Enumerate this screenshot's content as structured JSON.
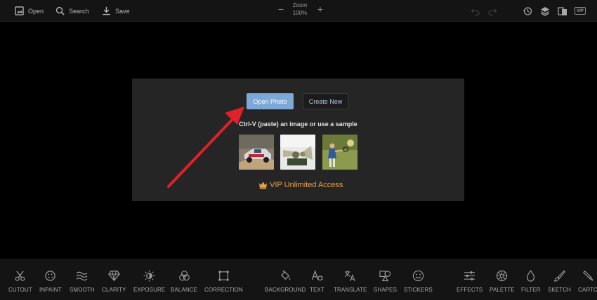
{
  "toolbar": {
    "open_label": "Open",
    "search_label": "Search",
    "save_label": "Save",
    "zoom_label": "Zoom",
    "zoom_value": "100%",
    "vip_tag": "VIP"
  },
  "dialog": {
    "open_photo": "Open Photo",
    "create_new": "Create New",
    "hint": "Ctrl-V (paste) an image or use a sample",
    "vip_link": "VIP Unlimited Access"
  },
  "tools": [
    {
      "label": "CUTOUT",
      "icon": "scissors-icon"
    },
    {
      "label": "INPAINT",
      "icon": "bandage-icon"
    },
    {
      "label": "SMOOTH",
      "icon": "waves-icon"
    },
    {
      "label": "CLARITY",
      "icon": "diamond-icon"
    },
    {
      "label": "EXPOSURE",
      "icon": "sun-icon"
    },
    {
      "label": "BALANCE",
      "icon": "circles-icon"
    },
    {
      "label": "CORRECTION",
      "icon": "crop-frame-icon"
    },
    {
      "label": "BACKGROUND",
      "icon": "paint-bucket-icon"
    },
    {
      "label": "TEXT",
      "icon": "text-icon"
    },
    {
      "label": "TRANSLATE",
      "icon": "translate-icon"
    },
    {
      "label": "SHAPES",
      "icon": "shapes-icon"
    },
    {
      "label": "STICKERS",
      "icon": "smiley-icon"
    },
    {
      "label": "EFFECTS",
      "icon": "sliders-icon"
    },
    {
      "label": "PALETTE",
      "icon": "palette-icon"
    },
    {
      "label": "FILTER",
      "icon": "drop-icon"
    },
    {
      "label": "SKETCH",
      "icon": "brush-icon"
    },
    {
      "label": "CARTO",
      "icon": "cartoon-icon"
    }
  ],
  "colors": {
    "accent": "#7ea8d8",
    "vip": "#e8a34a",
    "arrow": "#e0202a"
  }
}
